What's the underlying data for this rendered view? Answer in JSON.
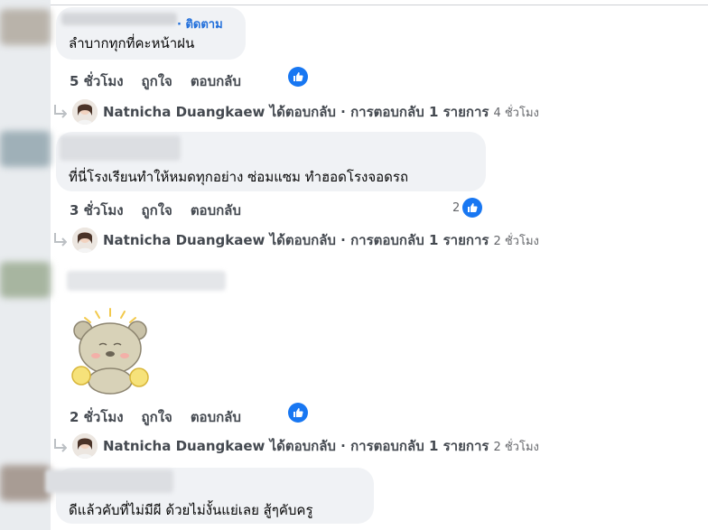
{
  "comments": [
    {
      "follow_label": "· ติดตาม",
      "text": "ลำบากทุกที่คะหน้าฝน",
      "time": "5 ชั่วโมง",
      "like_label": "ถูกใจ",
      "reply_label": "ตอบกลับ",
      "reactions": ""
    },
    {
      "text": "ที่นี่โรงเรียนทำให้หมดทุกอย่าง ซ่อมแซม ทำฮอดโรงจอดรถ",
      "time": "3 ชั่วโมง",
      "like_label": "ถูกใจ",
      "reply_label": "ตอบกลับ",
      "reactions": "2"
    },
    {
      "sticker": "bear-cheer-sticker",
      "time": "2 ชั่วโมง",
      "like_label": "ถูกใจ",
      "reply_label": "ตอบกลับ",
      "reactions": ""
    },
    {
      "text": "ดีแล้วคับที่ไม่มีผี ด้วยไม่งั้นแย่เลย สู้ๆคับครู"
    }
  ],
  "replies": [
    {
      "text": "Natnicha Duangkaew ได้ตอบกลับ · การตอบกลับ 1 รายการ",
      "time": "4 ชั่วโมง"
    },
    {
      "text": "Natnicha Duangkaew ได้ตอบกลับ · การตอบกลับ 1 รายการ",
      "time": "2 ชั่วโมง"
    },
    {
      "text": "Natnicha Duangkaew ได้ตอบกลับ · การตอบกลับ 1 รายการ",
      "time": "2 ชั่วโมง"
    }
  ],
  "colors": {
    "accent": "#1877f2",
    "follow": "#216fdb",
    "bubble": "#f0f2f5",
    "meta": "#65676b"
  },
  "icons": {
    "like": "like-thumb-icon",
    "reply": "reply-arrow-icon"
  }
}
